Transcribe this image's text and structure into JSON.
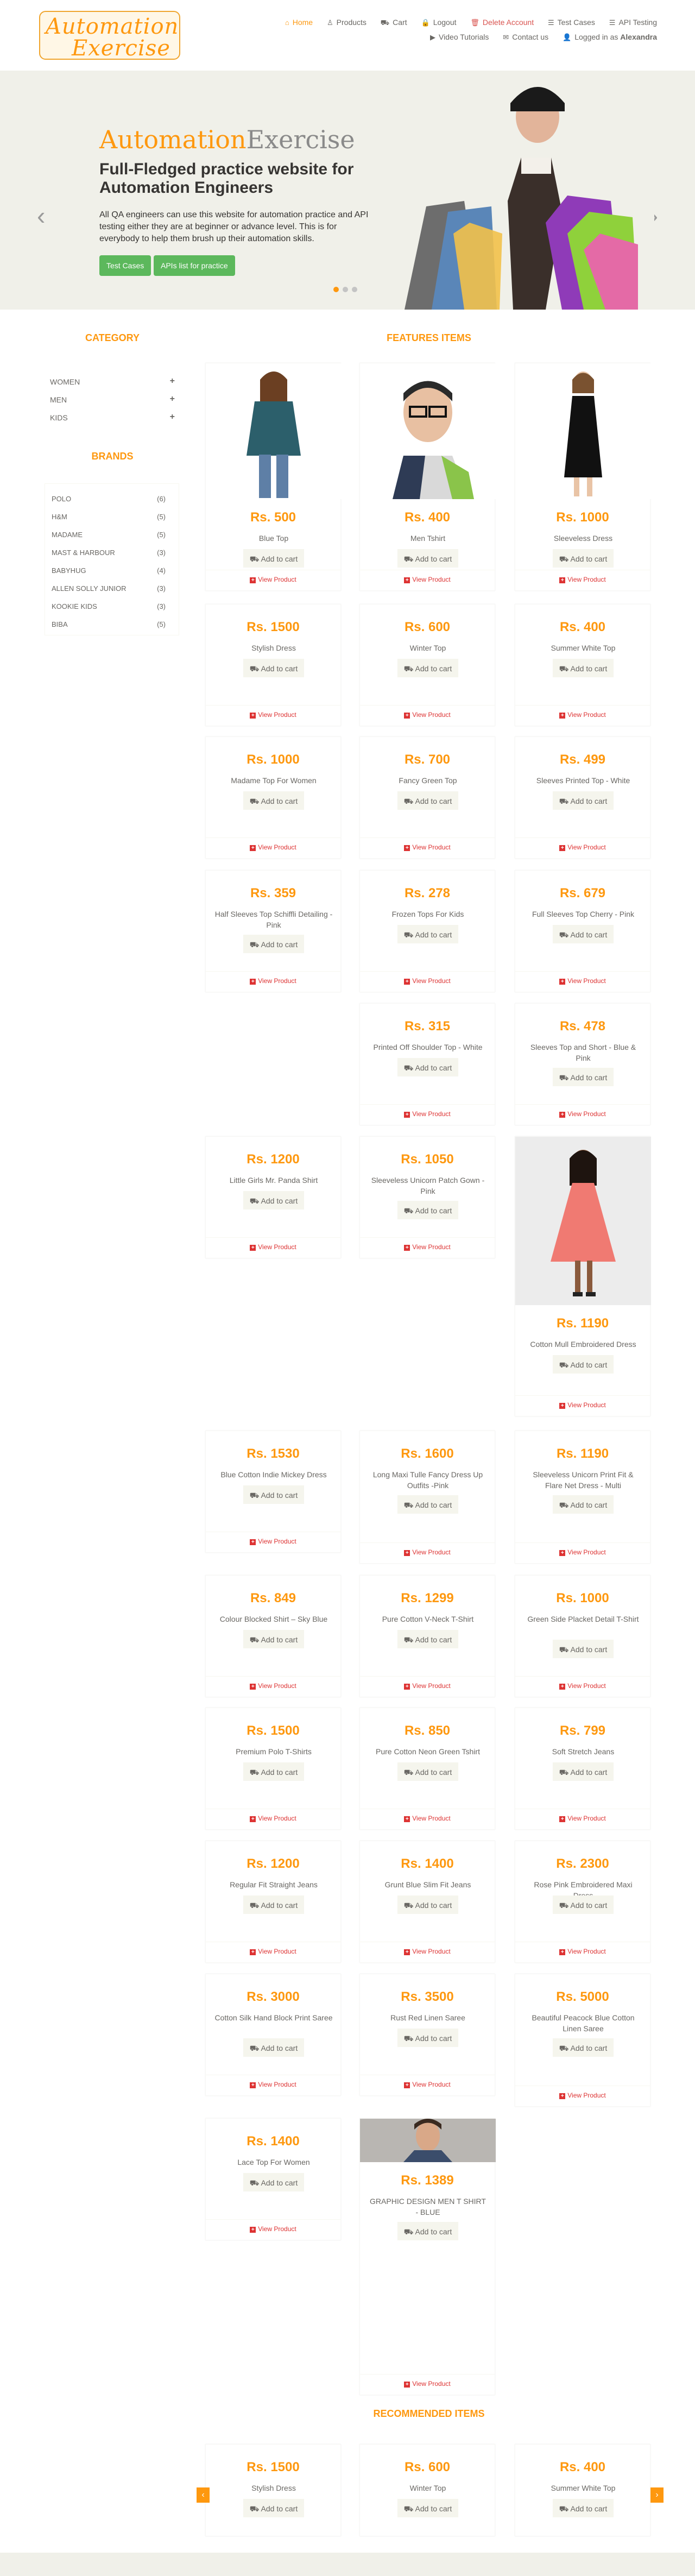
{
  "logo": {
    "line1": "Automation",
    "line2": "Exercise"
  },
  "nav": [
    {
      "label": "Home",
      "icon": "home-icon",
      "glyph": "⌂"
    },
    {
      "label": "Products",
      "icon": "shirt-icon",
      "glyph": "♙"
    },
    {
      "label": "Cart",
      "icon": "cart-icon",
      "glyph": "⛟"
    },
    {
      "label": "Logout",
      "icon": "lock-icon",
      "glyph": "🔒"
    },
    {
      "label": "Delete Account",
      "icon": "trash-icon",
      "glyph": "🗑"
    },
    {
      "label": "Test Cases",
      "icon": "list-icon",
      "glyph": "☰"
    },
    {
      "label": "API Testing",
      "icon": "list-icon",
      "glyph": "☰"
    },
    {
      "label": "Video Tutorials",
      "icon": "youtube-icon",
      "glyph": "▶"
    },
    {
      "label": "Contact us",
      "icon": "envelope-icon",
      "glyph": "✉"
    }
  ],
  "logged_in": {
    "prefix": "Logged in as",
    "user": "Alexandra"
  },
  "slider": {
    "title_a": "Automation",
    "title_b": "Exercise",
    "subtitle": "Full-Fledged practice website for Automation Engineers",
    "paragraph": "All QA engineers can use this website for automation practice and API testing either they are at beginner or advance level. This is for everybody to help them brush up their automation skills.",
    "btn_test_cases": "Test Cases",
    "btn_apis": "APIs list for practice"
  },
  "category": {
    "title": "Category",
    "items": [
      "Women",
      "Men",
      "Kids"
    ]
  },
  "brands": {
    "title": "Brands",
    "items": [
      {
        "name": "Polo",
        "count": "(6)"
      },
      {
        "name": "H&M",
        "count": "(5)"
      },
      {
        "name": "Madame",
        "count": "(5)"
      },
      {
        "name": "Mast & Harbour",
        "count": "(3)"
      },
      {
        "name": "Babyhug",
        "count": "(4)"
      },
      {
        "name": "Allen Solly Junior",
        "count": "(3)"
      },
      {
        "name": "Kookie Kids",
        "count": "(3)"
      },
      {
        "name": "Biba",
        "count": "(5)"
      }
    ]
  },
  "features_title": "Features Items",
  "recommended_title": "recommended items",
  "add_to_cart": "Add to cart",
  "view_product": "View Product",
  "products": [
    {
      "price": "Rs. 500",
      "name": "Blue Top"
    },
    {
      "price": "Rs. 400",
      "name": "Men Tshirt"
    },
    {
      "price": "Rs. 1000",
      "name": "Sleeveless Dress"
    },
    {
      "price": "Rs. 1500",
      "name": "Stylish Dress"
    },
    {
      "price": "Rs. 600",
      "name": "Winter Top"
    },
    {
      "price": "Rs. 400",
      "name": "Summer White Top"
    },
    {
      "price": "Rs. 1000",
      "name": "Madame Top For Women"
    },
    {
      "price": "Rs. 700",
      "name": "Fancy Green Top"
    },
    {
      "price": "Rs. 499",
      "name": "Sleeves Printed Top - White"
    },
    {
      "price": "Rs. 359",
      "name": "Half Sleeves Top Schiffli Detailing - Pink"
    },
    {
      "price": "Rs. 278",
      "name": "Frozen Tops For Kids"
    },
    {
      "price": "Rs. 679",
      "name": "Full Sleeves Top Cherry - Pink"
    },
    {
      "price": "Rs. 315",
      "name": "Printed Off Shoulder Top - White"
    },
    {
      "price": "Rs. 478",
      "name": "Sleeves Top and Short - Blue & Pink"
    },
    {
      "price": "Rs. 1200",
      "name": "Little Girls Mr. Panda Shirt"
    },
    {
      "price": "Rs. 1050",
      "name": "Sleeveless Unicorn Patch Gown - Pink"
    },
    {
      "price": "Rs. 1190",
      "name": "Cotton Mull Embroidered Dress"
    },
    {
      "price": "Rs. 1530",
      "name": "Blue Cotton Indie Mickey Dress"
    },
    {
      "price": "Rs. 1600",
      "name": "Long Maxi Tulle Fancy Dress Up Outfits -Pink"
    },
    {
      "price": "Rs. 1190",
      "name": "Sleeveless Unicorn Print Fit & Flare Net Dress - Multi"
    },
    {
      "price": "Rs. 849",
      "name": "Colour Blocked Shirt – Sky Blue"
    },
    {
      "price": "Rs. 1299",
      "name": "Pure Cotton V-Neck T-Shirt"
    },
    {
      "price": "Rs. 1000",
      "name": "Green Side Placket Detail T-Shirt"
    },
    {
      "price": "Rs. 1500",
      "name": "Premium Polo T-Shirts"
    },
    {
      "price": "Rs. 850",
      "name": "Pure Cotton Neon Green Tshirt"
    },
    {
      "price": "Rs. 799",
      "name": "Soft Stretch Jeans"
    },
    {
      "price": "Rs. 1200",
      "name": "Regular Fit Straight Jeans"
    },
    {
      "price": "Rs. 1400",
      "name": "Grunt Blue Slim Fit Jeans"
    },
    {
      "price": "Rs. 2300",
      "name": "Rose Pink Embroidered Maxi Dress"
    },
    {
      "price": "Rs. 3000",
      "name": "Cotton Silk Hand Block Print Saree"
    },
    {
      "price": "Rs. 3500",
      "name": "Rust Red Linen Saree"
    },
    {
      "price": "Rs. 5000",
      "name": "Beautiful Peacock Blue Cotton Linen Saree"
    },
    {
      "price": "Rs. 1400",
      "name": "Lace Top For Women"
    },
    {
      "price": "Rs. 1389",
      "name": "GRAPHIC DESIGN MEN T SHIRT - BLUE"
    }
  ],
  "recommended": [
    {
      "price": "Rs. 1500",
      "name": "Stylish Dress"
    },
    {
      "price": "Rs. 600",
      "name": "Winter Top"
    },
    {
      "price": "Rs. 400",
      "name": "Summer White Top"
    }
  ],
  "colors": {
    "accent": "#FE980F",
    "green": "#5cb85c",
    "bg": "#F0F0E9",
    "danger": "#d33"
  }
}
